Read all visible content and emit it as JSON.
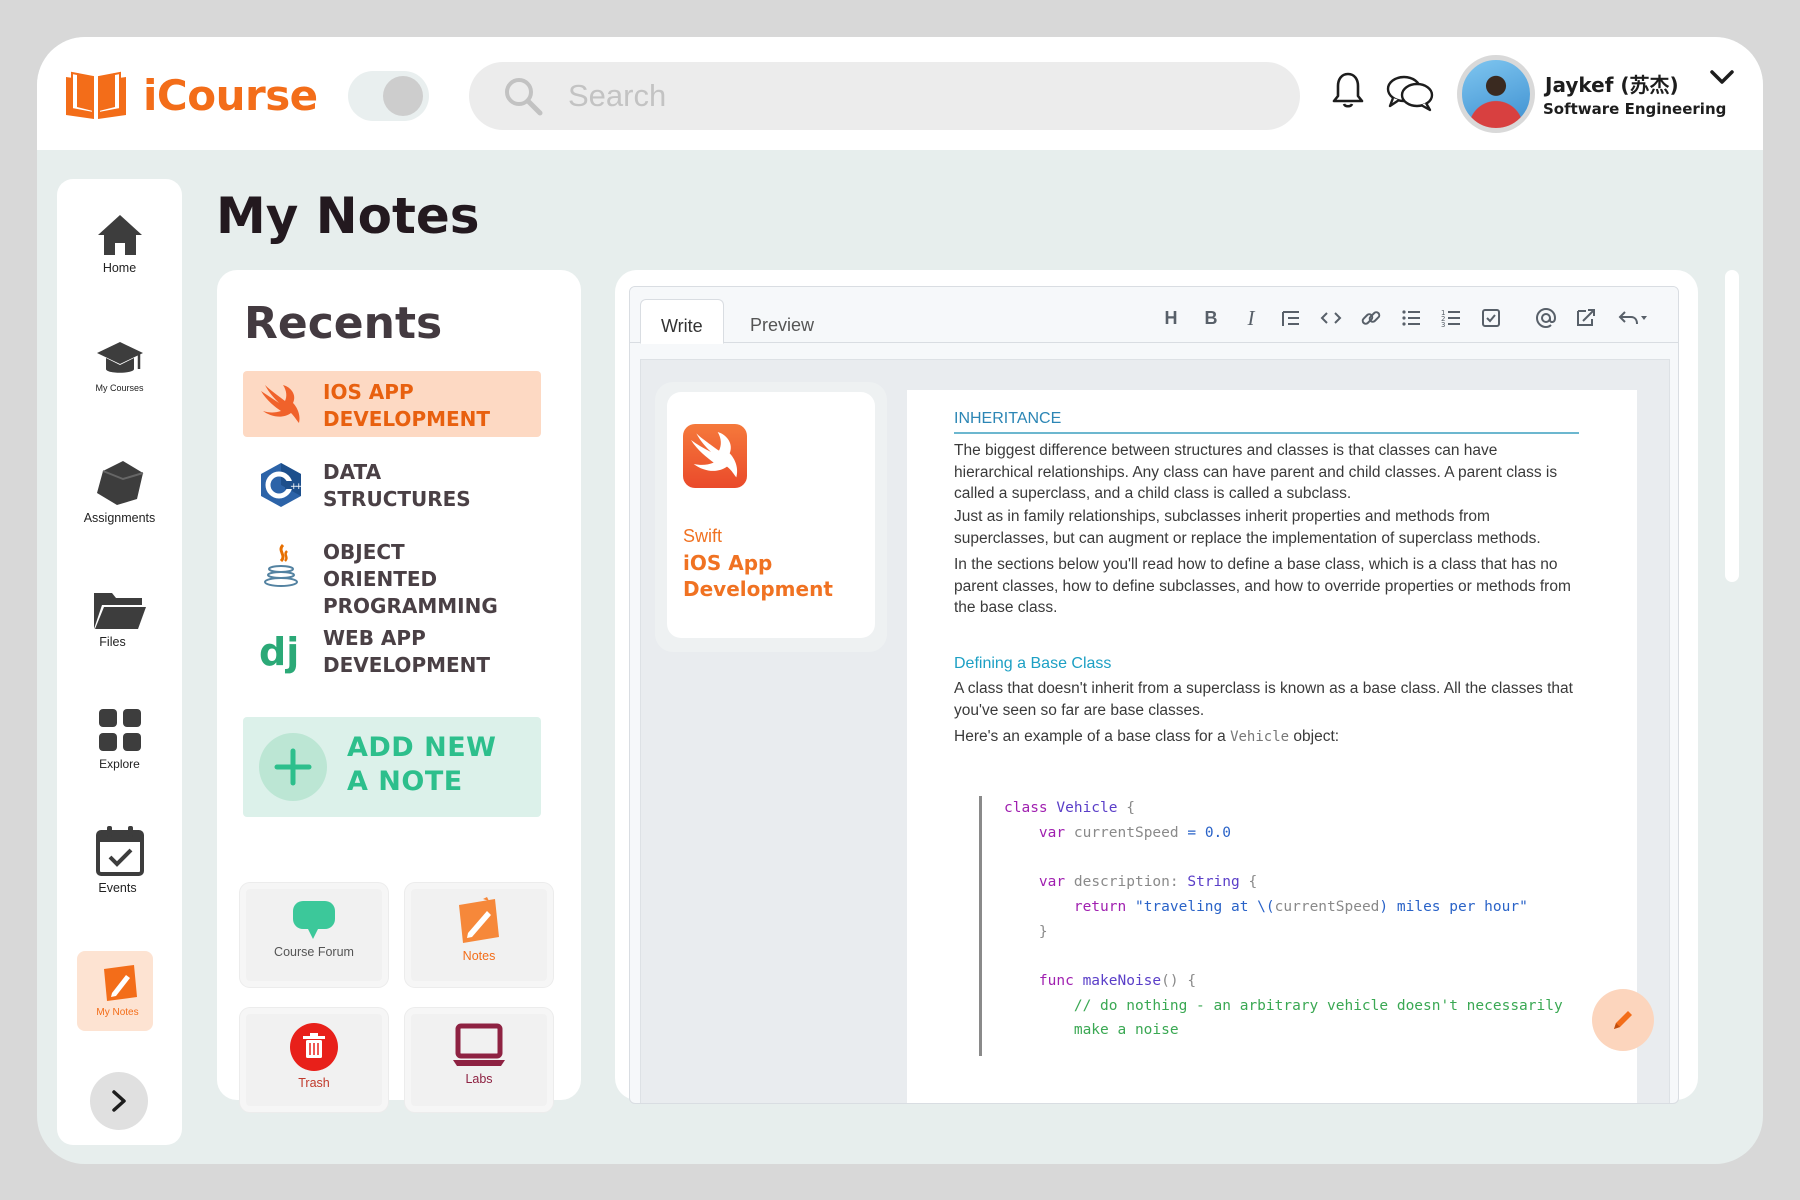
{
  "app": {
    "brand": "iCourse",
    "accent_color": "#f36d19"
  },
  "header": {
    "search_placeholder": "Search",
    "icons": [
      "book-logo-icon",
      "search-icon",
      "bell-icon",
      "chat-icon",
      "chevron-down-icon"
    ],
    "user": {
      "name": "Jaykef (苏杰)",
      "role": "Software Engineering"
    }
  },
  "sidebar": {
    "items": [
      {
        "label": "Home",
        "icon": "home-icon"
      },
      {
        "label": "My Courses",
        "icon": "graduation-cap-icon"
      },
      {
        "label": "Assignments",
        "icon": "assignments-icon"
      },
      {
        "label": "Files",
        "icon": "folder-icon"
      },
      {
        "label": "Explore",
        "icon": "grid-icon"
      },
      {
        "label": "Events",
        "icon": "calendar-icon"
      },
      {
        "label": "My Notes",
        "icon": "notes-icon",
        "active": true
      }
    ],
    "expand_icon": "chevron-right-icon"
  },
  "page": {
    "title": "My Notes"
  },
  "recents": {
    "title": "Recents",
    "items": [
      {
        "label": "iOS App Development",
        "icon": "swift-icon",
        "active": true
      },
      {
        "label": "Data Structures",
        "icon": "cpp-icon"
      },
      {
        "label": "Object Oriented Programming",
        "icon": "java-icon"
      },
      {
        "label": "Web App Development",
        "icon": "django-icon"
      }
    ],
    "add_note_label": "Add New A Note",
    "tiles": [
      {
        "label": "Course Forum",
        "icon": "forum-icon"
      },
      {
        "label": "Notes",
        "icon": "notes-icon"
      },
      {
        "label": "Trash",
        "icon": "trash-icon"
      },
      {
        "label": "Labs",
        "icon": "laptop-icon"
      }
    ]
  },
  "editor": {
    "tabs": [
      {
        "label": "Write",
        "active": true
      },
      {
        "label": "Preview"
      }
    ],
    "toolbar": [
      "heading",
      "bold",
      "italic",
      "quote",
      "code",
      "link",
      "bulleted-list",
      "numbered-list",
      "task-list",
      "mention",
      "reference",
      "undo"
    ],
    "course_card": {
      "tag": "Swift",
      "name": "iOS App Development"
    },
    "document": {
      "heading": "INHERITANCE",
      "paragraphs": [
        "The biggest difference between structures and classes is that classes can have hierarchical relationships. Any class can have parent and child classes. A parent class is called a superclass, and a child class is called a subclass.",
        "Just as in family relationships, subclasses inherit properties and methods from superclasses, but can augment or replace the implementation of superclass methods.",
        "In the sections below you'll read how to define a base class, which is a class that has no parent classes, how to define subclasses, and how to override properties or methods from the base class."
      ],
      "subheading": "Defining a Base Class",
      "base_class_text": "A class that doesn't inherit from a superclass is known as a base class. All the classes that you've seen so far are base classes.",
      "example_intro": "Here's an example of a base class for a",
      "example_code_word": "Vehicle",
      "example_suffix": "object:",
      "code": {
        "line1_kw": "class",
        "line1_name": "Vehicle",
        "line2_kw": "var",
        "line2_name": "currentSpeed",
        "line2_value": "0.0",
        "line3_kw": "var",
        "line3_name": "description",
        "line3_type": "String",
        "line4_kw": "return",
        "line4_str_a": "\"traveling at \\(",
        "line4_var": "currentSpeed",
        "line4_str_b": ") miles per hour\"",
        "line5_kw": "func",
        "line5_name": "makeNoise",
        "line6_comment": "// do nothing - an arbitrary vehicle doesn't necessarily",
        "line7_comment": "make a noise"
      }
    },
    "fab_icon": "pencil-icon"
  }
}
